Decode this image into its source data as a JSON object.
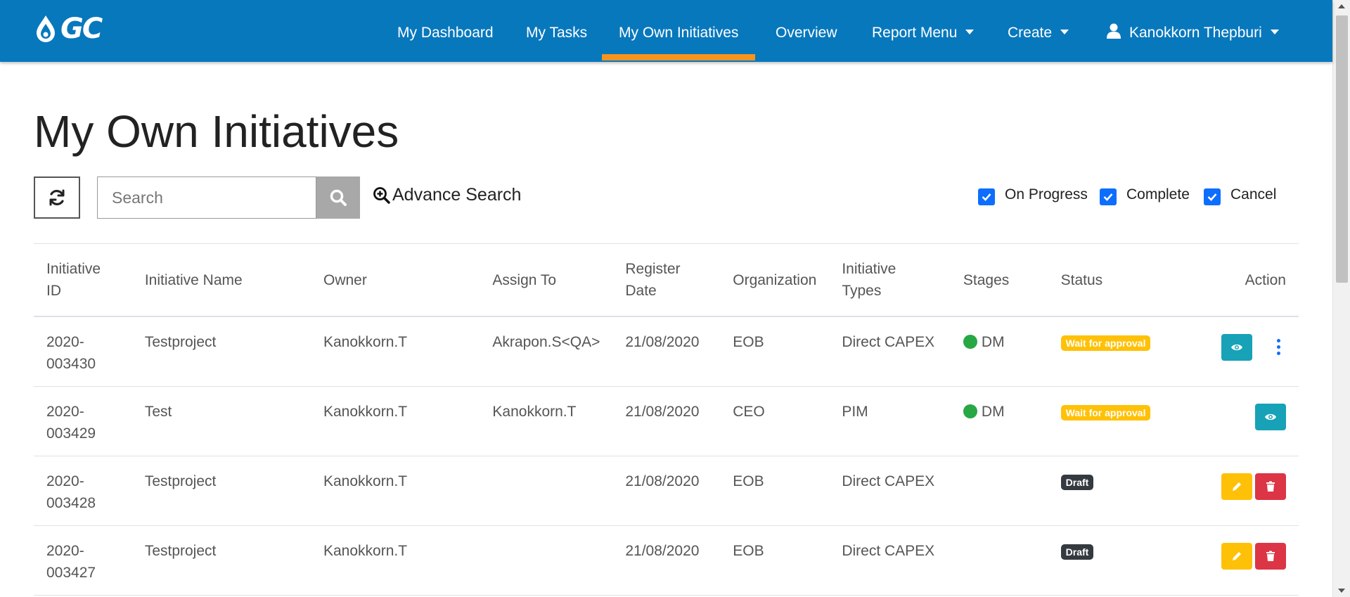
{
  "nav": {
    "brand": "GC",
    "items": [
      {
        "label": "My Dashboard"
      },
      {
        "label": "My Tasks"
      },
      {
        "label": "My Own Initiatives"
      },
      {
        "label": "Overview"
      },
      {
        "label": "Report Menu"
      },
      {
        "label": "Create"
      }
    ],
    "user": "Kanokkorn Thepburi",
    "active_index": 2
  },
  "page": {
    "title": "My Own Initiatives"
  },
  "toolbar": {
    "search_placeholder": "Search",
    "advance_search": "Advance Search",
    "filters": [
      {
        "label": "On Progress",
        "checked": true
      },
      {
        "label": "Complete",
        "checked": true
      },
      {
        "label": "Cancel",
        "checked": true
      }
    ]
  },
  "table": {
    "headers": {
      "id": "Initiative ID",
      "name": "Initiative Name",
      "owner": "Owner",
      "assign": "Assign To",
      "date": "Register Date",
      "org": "Organization",
      "types": "Initiative Types",
      "stages": "Stages",
      "status": "Status",
      "action": "Action"
    },
    "rows": [
      {
        "id": "2020-003430",
        "name": "Testproject",
        "owner": "Kanokkorn.T",
        "assign": "Akrapon.S<QA>",
        "date": "21/08/2020",
        "org": "EOB",
        "types": "Direct CAPEX",
        "stage": "DM",
        "status": "Wait for approval",
        "status_color": "#ffc107"
      },
      {
        "id": "2020-003429",
        "name": "Test",
        "owner": "Kanokkorn.T",
        "assign": "Kanokkorn.T",
        "date": "21/08/2020",
        "org": "CEO",
        "types": "PIM",
        "stage": "DM",
        "status": "Wait for approval",
        "status_color": "#ffc107"
      },
      {
        "id": "2020-003428",
        "name": "Testproject",
        "owner": "Kanokkorn.T",
        "assign": "",
        "date": "21/08/2020",
        "org": "EOB",
        "types": "Direct CAPEX",
        "stage": "",
        "status": "Draft",
        "status_color": "#343a40"
      },
      {
        "id": "2020-003427",
        "name": "Testproject",
        "owner": "Kanokkorn.T",
        "assign": "",
        "date": "21/08/2020",
        "org": "EOB",
        "types": "Direct CAPEX",
        "stage": "",
        "status": "Draft",
        "status_color": "#343a40"
      }
    ]
  },
  "colors": {
    "navbar": "#0878bd",
    "active_underline": "#f7941d",
    "stage_dot": "#28a745",
    "view_button": "#17a2b8",
    "edit_button": "#ffc107",
    "delete_button": "#dc3545",
    "checkbox": "#0d6efd"
  }
}
